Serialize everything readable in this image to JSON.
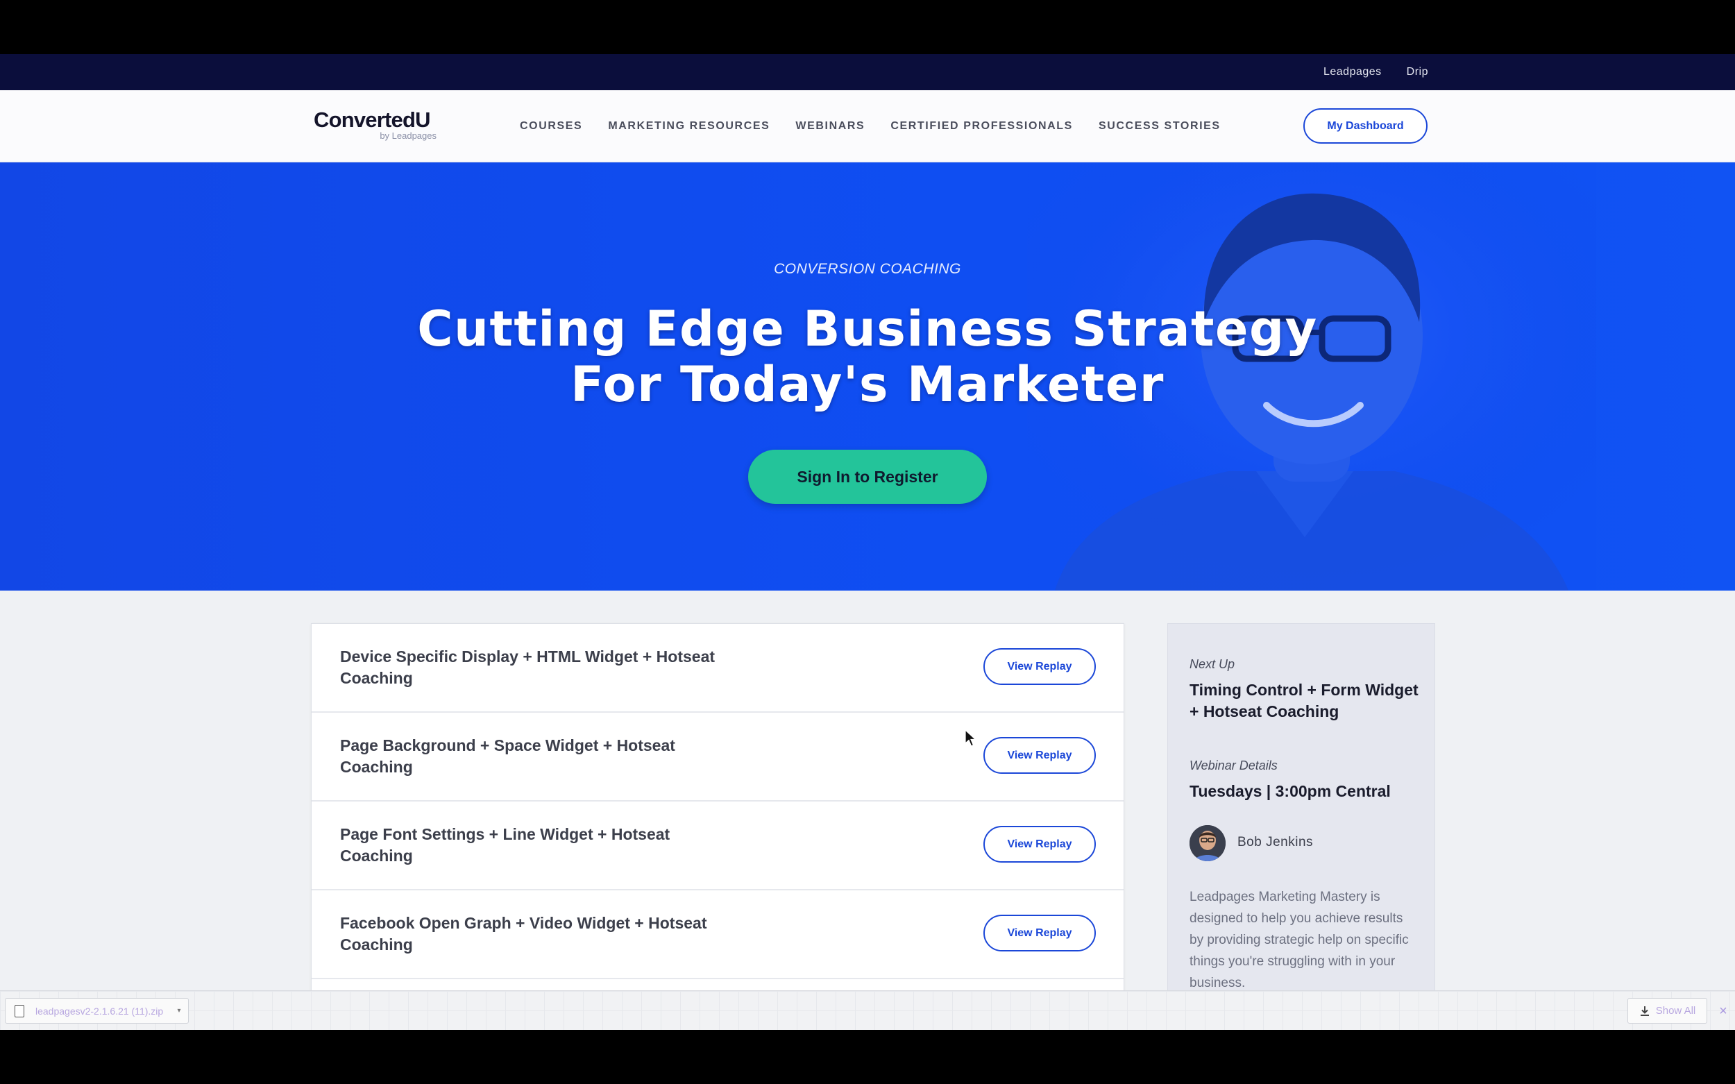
{
  "utility_bar": {
    "links": [
      "Leadpages",
      "Drip"
    ]
  },
  "nav": {
    "logo_text": "ConvertedU",
    "logo_sub": "by Leadpages",
    "items": [
      "COURSES",
      "MARKETING RESOURCES",
      "WEBINARS",
      "CERTIFIED PROFESSIONALS",
      "SUCCESS STORIES"
    ],
    "dashboard_button": "My Dashboard"
  },
  "hero": {
    "eyebrow": "CONVERSION COACHING",
    "title_line1": "Cutting Edge Business Strategy",
    "title_line2": "For Today's Marketer",
    "cta": "Sign In to Register"
  },
  "replays": {
    "button_label": "View Replay",
    "items": [
      "Device Specific Display + HTML Widget + Hotseat Coaching",
      "Page Background + Space Widget + Hotseat Coaching",
      "Page Font Settings + Line Widget + Hotseat Coaching",
      "Facebook Open Graph + Video Widget + Hotseat Coaching"
    ]
  },
  "sidebar": {
    "next_up_label": "Next Up",
    "next_up_title": "Timing Control + Form Widget + Hotseat Coaching",
    "details_label": "Webinar Details",
    "details_value": "Tuesdays | 3:00pm Central",
    "presenter_name": "Bob Jenkins",
    "description": "Leadpages Marketing Mastery is designed to help you achieve results by providing strategic help on specific things you're struggling with in your business."
  },
  "download_bar": {
    "file_name": "leadpagesv2-2.1.6.21 (11).zip",
    "show_all": "Show All"
  },
  "colors": {
    "utility_bar": "#0b0e3c",
    "hero_blue": "#1247e6",
    "cta_green": "#23c49a",
    "accent_blue": "#1b47d8"
  }
}
